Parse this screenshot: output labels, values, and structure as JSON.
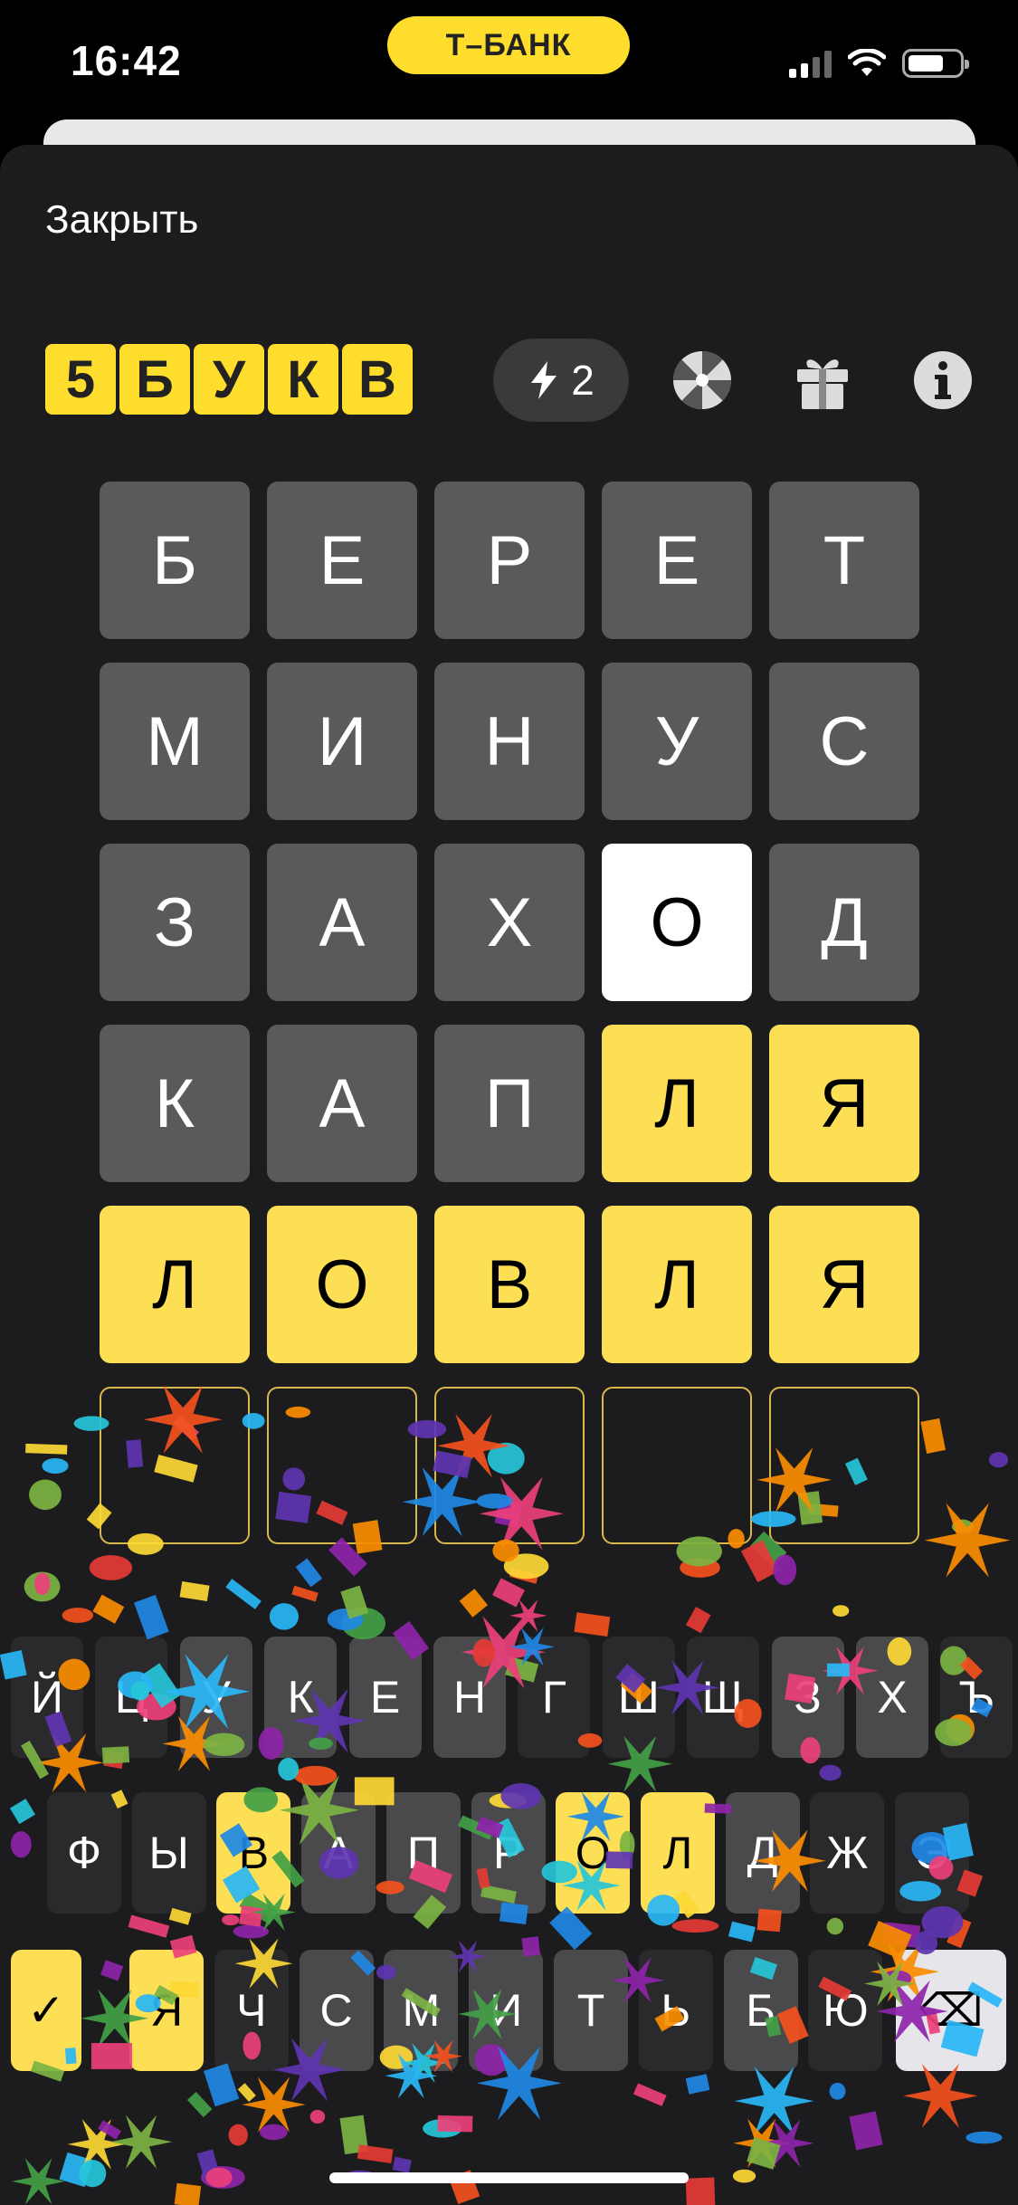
{
  "status_bar": {
    "time": "16:42",
    "bank_label": "Т–БАНК"
  },
  "header": {
    "close_label": "Закрыть"
  },
  "game": {
    "logo_letters": [
      "5",
      "Б",
      "У",
      "К",
      "В"
    ],
    "energy_count": "2",
    "icons": [
      "lightning-icon",
      "wheel-icon",
      "gift-icon",
      "info-icon"
    ]
  },
  "board": {
    "rows": [
      [
        {
          "l": "Б",
          "s": "gray"
        },
        {
          "l": "Е",
          "s": "gray"
        },
        {
          "l": "Р",
          "s": "gray"
        },
        {
          "l": "Е",
          "s": "gray"
        },
        {
          "l": "Т",
          "s": "gray"
        }
      ],
      [
        {
          "l": "М",
          "s": "gray"
        },
        {
          "l": "И",
          "s": "gray"
        },
        {
          "l": "Н",
          "s": "gray"
        },
        {
          "l": "У",
          "s": "gray"
        },
        {
          "l": "С",
          "s": "gray"
        }
      ],
      [
        {
          "l": "З",
          "s": "gray"
        },
        {
          "l": "А",
          "s": "gray"
        },
        {
          "l": "Х",
          "s": "gray"
        },
        {
          "l": "О",
          "s": "white"
        },
        {
          "l": "Д",
          "s": "gray"
        }
      ],
      [
        {
          "l": "К",
          "s": "gray"
        },
        {
          "l": "А",
          "s": "gray"
        },
        {
          "l": "П",
          "s": "gray"
        },
        {
          "l": "Л",
          "s": "yellow"
        },
        {
          "l": "Я",
          "s": "yellow"
        }
      ],
      [
        {
          "l": "Л",
          "s": "yellow"
        },
        {
          "l": "О",
          "s": "yellow"
        },
        {
          "l": "В",
          "s": "yellow"
        },
        {
          "l": "Л",
          "s": "yellow"
        },
        {
          "l": "Я",
          "s": "yellow"
        }
      ],
      [
        {
          "l": "",
          "s": "empty"
        },
        {
          "l": "",
          "s": "empty"
        },
        {
          "l": "",
          "s": "empty"
        },
        {
          "l": "",
          "s": "empty"
        },
        {
          "l": "",
          "s": "empty"
        }
      ]
    ]
  },
  "keyboard": {
    "row1": [
      {
        "k": "Й",
        "s": "dark"
      },
      {
        "k": "Ц",
        "s": "dark"
      },
      {
        "k": "У",
        "s": "gray"
      },
      {
        "k": "К",
        "s": "gray"
      },
      {
        "k": "Е",
        "s": "gray"
      },
      {
        "k": "Н",
        "s": "gray"
      },
      {
        "k": "Г",
        "s": "dark"
      },
      {
        "k": "Ш",
        "s": "dark"
      },
      {
        "k": "Щ",
        "s": "dark"
      },
      {
        "k": "З",
        "s": "gray"
      },
      {
        "k": "Х",
        "s": "gray"
      },
      {
        "k": "Ъ",
        "s": "dark"
      }
    ],
    "row2": [
      {
        "k": "Ф",
        "s": "dark"
      },
      {
        "k": "Ы",
        "s": "dark"
      },
      {
        "k": "В",
        "s": "yellow"
      },
      {
        "k": "А",
        "s": "gray"
      },
      {
        "k": "П",
        "s": "gray"
      },
      {
        "k": "Р",
        "s": "gray"
      },
      {
        "k": "О",
        "s": "yellow"
      },
      {
        "k": "Л",
        "s": "yellow"
      },
      {
        "k": "Д",
        "s": "gray"
      },
      {
        "k": "Ж",
        "s": "dark"
      },
      {
        "k": "Э",
        "s": "dark"
      }
    ],
    "row3": [
      {
        "k": "✓",
        "s": "yellow"
      },
      {
        "k": "Я",
        "s": "yellow"
      },
      {
        "k": "Ч",
        "s": "dark"
      },
      {
        "k": "С",
        "s": "gray"
      },
      {
        "k": "М",
        "s": "gray"
      },
      {
        "k": "И",
        "s": "gray"
      },
      {
        "k": "Т",
        "s": "gray"
      },
      {
        "k": "Ь",
        "s": "dark"
      },
      {
        "k": "Б",
        "s": "gray"
      },
      {
        "k": "Ю",
        "s": "dark"
      },
      {
        "k": "⌫",
        "s": "light"
      }
    ]
  },
  "colors": {
    "accent_yellow": "#ffdd2d",
    "tile_gray": "#5a5a5c",
    "background": "#1c1c1e"
  }
}
